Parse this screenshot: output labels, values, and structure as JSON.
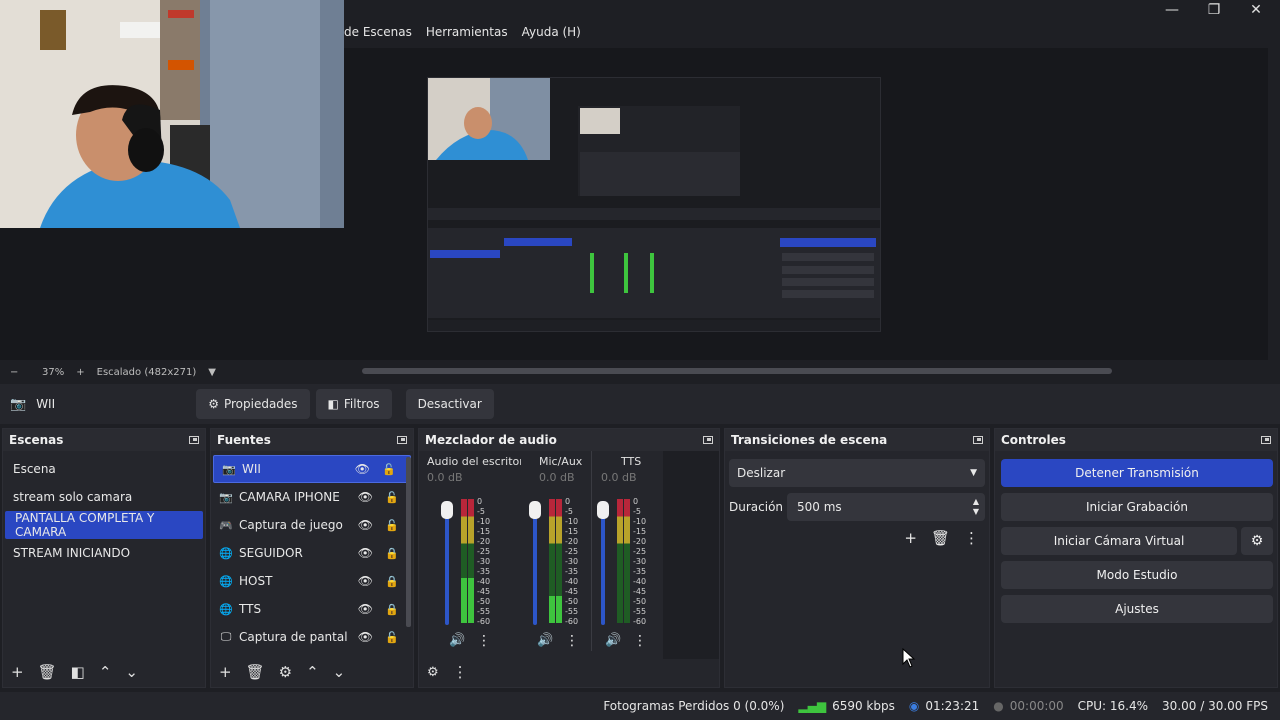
{
  "window": {
    "minimize_glyph": "—",
    "maximize_glyph": "❐",
    "close_glyph": "✕"
  },
  "menu": [
    "de Escenas",
    "Herramientas",
    "Ayuda (H)"
  ],
  "zoom": {
    "minus": "−",
    "value": "37%",
    "plus": "+",
    "scale": "Escalado (482x271)"
  },
  "source_toolbar": {
    "source_name": "WII",
    "properties": "Propiedades",
    "filters": "Filtros",
    "deactivate": "Desactivar"
  },
  "scenes": {
    "title": "Escenas",
    "items": [
      "Escena",
      "stream solo camara",
      "PANTALLA COMPLETA Y CAMARA",
      "STREAM INICIANDO"
    ],
    "selected_index": 2
  },
  "sources": {
    "title": "Fuentes",
    "items": [
      {
        "name": "WII",
        "icon": "camera-icon",
        "locked": false
      },
      {
        "name": "CAMARA IPHONE",
        "icon": "camera-icon",
        "locked": false
      },
      {
        "name": "Captura de juego",
        "icon": "gamepad-icon",
        "locked": false
      },
      {
        "name": "SEGUIDOR",
        "icon": "globe-icon",
        "locked": true
      },
      {
        "name": "HOST",
        "icon": "globe-icon",
        "locked": true
      },
      {
        "name": "TTS",
        "icon": "globe-icon",
        "locked": true
      },
      {
        "name": "Captura de pantalla",
        "icon": "monitor-icon",
        "locked": false
      }
    ],
    "selected_index": 0
  },
  "mixer": {
    "title": "Mezclador de audio",
    "channels": [
      {
        "name": "Audio del escritorio",
        "db": "0.0 dB",
        "level": 0.36
      },
      {
        "name": "Mic/Aux",
        "db": "0.0 dB",
        "level": 0.22
      },
      {
        "name": "TTS",
        "db": "0.0 dB",
        "level": 0
      }
    ],
    "ticks": [
      "0",
      "-5",
      "-10",
      "-15",
      "-20",
      "-25",
      "-30",
      "-35",
      "-40",
      "-45",
      "-50",
      "-55",
      "-60"
    ]
  },
  "transitions": {
    "title": "Transiciones de escena",
    "selected": "Deslizar",
    "duration_label": "Duración",
    "duration_value": "500 ms"
  },
  "controls": {
    "title": "Controles",
    "stop_stream": "Detener Transmisión",
    "start_recording": "Iniciar Grabación",
    "start_virtual_cam": "Iniciar Cámara Virtual",
    "studio_mode": "Modo Estudio",
    "settings": "Ajustes"
  },
  "status": {
    "dropped_frames": "Fotogramas Perdidos 0 (0.0%)",
    "bitrate": "6590 kbps",
    "stream_time": "01:23:21",
    "record_time": "00:00:00",
    "cpu": "CPU: 16.4%",
    "fps": "30.00 / 30.00 FPS"
  },
  "colors": {
    "accent": "#2a47c2",
    "bg": "#1e1f24",
    "panel": "#25262c",
    "meter_green": "#3ec43e",
    "meter_yellow": "#b9a32a",
    "meter_red": "#b8263a"
  }
}
